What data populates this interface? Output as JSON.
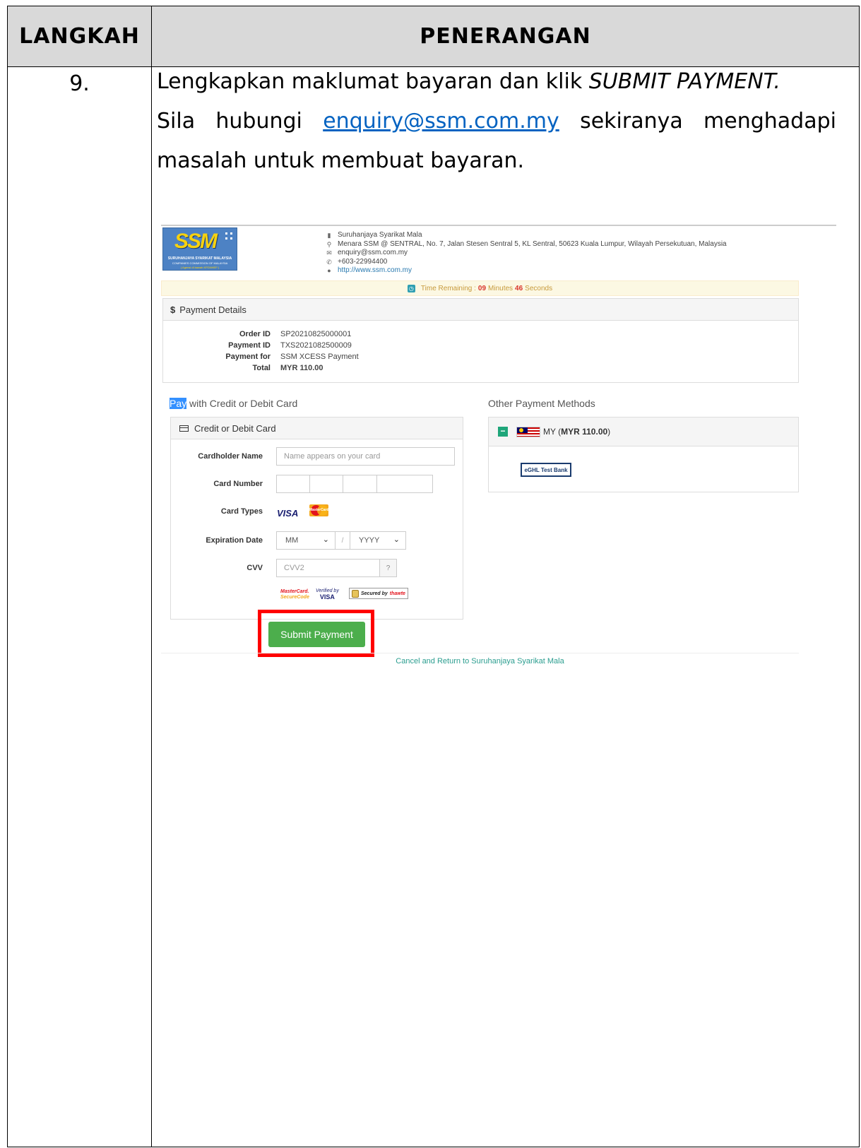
{
  "table": {
    "header_step": "LANGKAH",
    "header_desc": "PENERANGAN",
    "step_number": "9.",
    "line1_text": "Lengkapkan maklumat bayaran dan klik ",
    "line1_em": "SUBMIT PAYMENT.",
    "line2_pre": "Sila hubungi ",
    "line2_link": "enquiry@ssm.com.my",
    "line2_post": " sekiranya menghadapi",
    "line3": "masalah untuk membuat bayaran."
  },
  "screenshot": {
    "logo": {
      "text": "SSM",
      "sub1": "SURUHANJAYA SYARIKAT MALAYSIA",
      "sub2": "COMPANIES COMMISSION OF MALAYSIA",
      "sub3": "( Agensi di bawah KPDNHEP )"
    },
    "company": {
      "name": "Suruhanjaya Syarikat Mala",
      "address": "Menara SSM @ SENTRAL, No. 7, Jalan Stesen Sentral 5, KL Sentral, 50623 Kuala Lumpur, Wilayah Persekutuan, Malaysia",
      "email": "enquiry@ssm.com.my",
      "phone": "+603-22994400",
      "website": "http://www.ssm.com.my"
    },
    "timer": {
      "label": "Time Remaining :",
      "minutes": "09",
      "minutes_label": "Minutes",
      "seconds": "46",
      "seconds_label": "Seconds"
    },
    "payment_details": {
      "title": "Payment Details",
      "rows": [
        {
          "k": "Order ID",
          "v": "SP20210825000001"
        },
        {
          "k": "Payment ID",
          "v": "TXS2021082500009"
        },
        {
          "k": "Payment for",
          "v": "SSM XCESS Payment"
        },
        {
          "k": "Total",
          "v": "MYR 110.00"
        }
      ]
    },
    "card_form": {
      "section_title_highlight": "Pay",
      "section_title_rest": " with Credit or Debit Card",
      "panel_title": "Credit or Debit Card",
      "cardholder_label": "Cardholder Name",
      "cardholder_placeholder": "Name appears on your card",
      "card_number_label": "Card Number",
      "card_types_label": "Card Types",
      "visa": "VISA",
      "mastercard": "MasterCard",
      "expiry_label": "Expiration Date",
      "month_value": "MM",
      "year_value": "YYYY",
      "slash": "/",
      "cvv_label": "CVV",
      "cvv_placeholder": "CVV2",
      "badge_mc_1": "MasterCard.",
      "badge_mc_2": "SecureCode",
      "badge_vv_1": "Verified by",
      "badge_vv_2": "VISA",
      "badge_thawte_1": "Secured by",
      "badge_thawte_2": "thawte",
      "submit": "Submit Payment"
    },
    "other_methods": {
      "title": "Other Payment Methods",
      "country": "MY (",
      "amount": "MYR 110.00",
      "close": ")",
      "bank": "eGHL Test Bank"
    },
    "cancel_link": "Cancel and Return to Suruhanjaya Syarikat Mala"
  }
}
